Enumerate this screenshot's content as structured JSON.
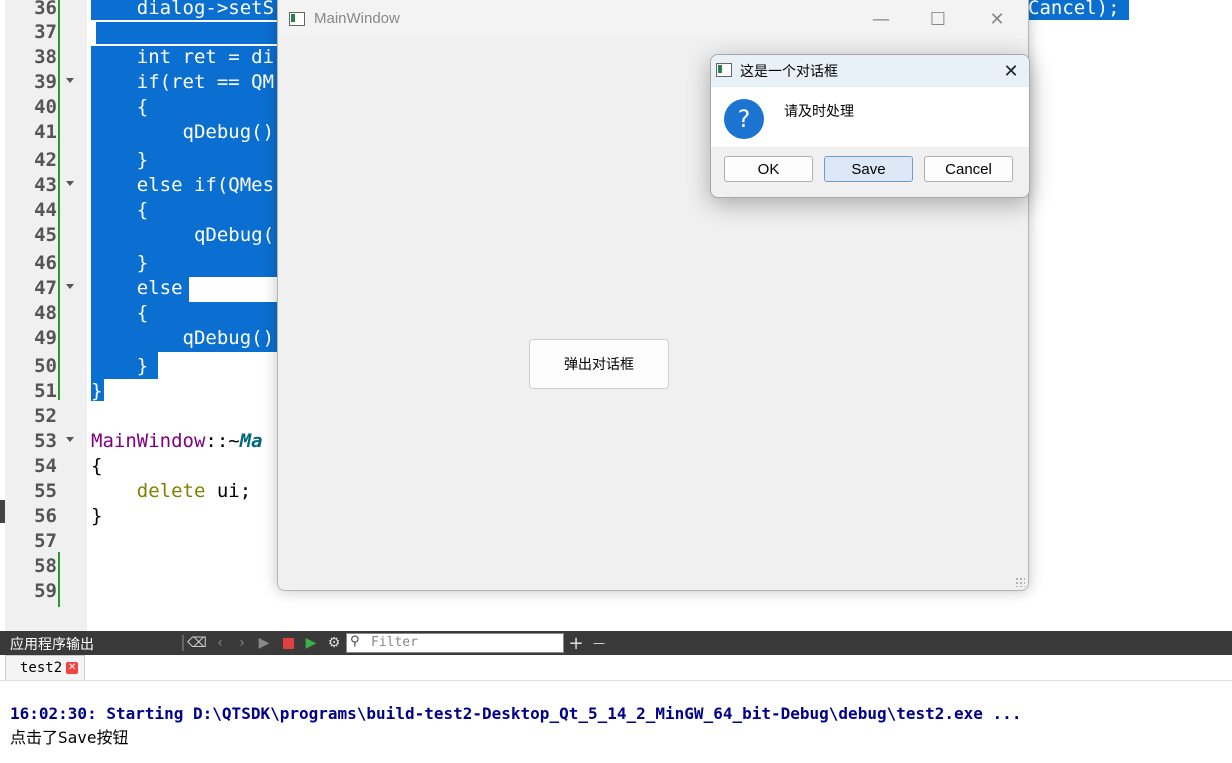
{
  "editor": {
    "line_numbers": [
      "36",
      "37",
      "38",
      "39",
      "40",
      "41",
      "42",
      "43",
      "44",
      "45",
      "46",
      "47",
      "48",
      "49",
      "50",
      "51",
      "52",
      "53",
      "54",
      "55",
      "56",
      "57",
      "58",
      "59"
    ],
    "lines": {
      "l36": "    dialog->setS",
      "l36_right": "Cancel);",
      "l38": "    int ret = di",
      "l39": "    if(ret == QM",
      "l40": "    {",
      "l41": "        qDebug()",
      "l42": "    }",
      "l43": "    else if(QMes",
      "l44": "    {",
      "l45": "         qDebug(",
      "l46": "    }",
      "l47": "    else",
      "l48": "    {",
      "l49": "        qDebug()",
      "l50": "    }",
      "l51": "}",
      "l53_cls": "MainWindow",
      "l53_sep": "::~",
      "l53_fn": "Ma",
      "l54": "{",
      "l55_kw": "delete",
      "l55_rest": " ui;",
      "l56": "}"
    }
  },
  "main_window": {
    "title": "MainWindow",
    "minimize_glyph": "—",
    "maximize_glyph": "☐",
    "close_glyph": "✕",
    "popup_button_label": "弹出对话框"
  },
  "dialog": {
    "title": "这是一个对话框",
    "close_glyph": "✕",
    "icon_glyph": "?",
    "message": "请及时处理",
    "buttons": {
      "ok": "OK",
      "save": "Save",
      "cancel": "Cancel"
    }
  },
  "output_pane": {
    "title": "应用程序输出",
    "filter_placeholder": "Filter",
    "add_glyph": "+",
    "remove_glyph": "—",
    "tab_label": "test2",
    "tab_close_glyph": "✕",
    "lines": [
      "16:02:30: Starting D:\\QTSDK\\programs\\build-test2-Desktop_Qt_5_14_2_MinGW_64_bit-Debug\\debug\\test2.exe ...",
      "点击了Save按钮"
    ]
  },
  "colors": {
    "selection": "#0a6fd0",
    "change_marker": "#2e9a2e",
    "output_highlight": "#00008b",
    "question_icon": "#1b74d1"
  }
}
